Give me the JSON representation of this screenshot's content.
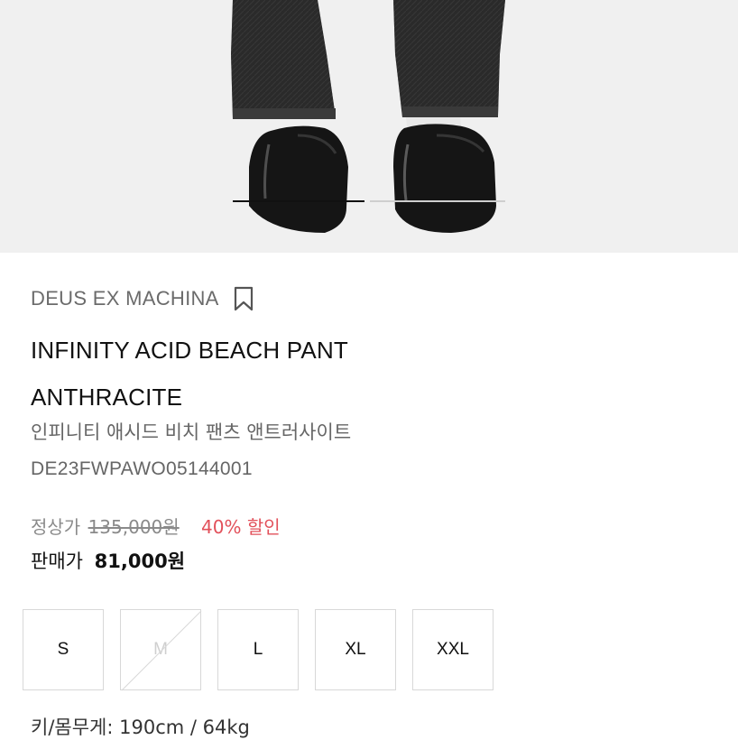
{
  "product": {
    "brand": "DEUS EX MACHINA",
    "title_line1": "INFINITY ACID BEACH PANT",
    "title_line2": "ANTHRACITE",
    "title_kr": "인피니티 애시드 비치 팬츠 앤트러사이트",
    "sku": "DE23FWPAWO05144001",
    "original_price_label": "정상가",
    "original_price": "135,000원",
    "discount_label": "40% 할인",
    "sale_price_label": "판매가",
    "sale_price": "81,000원",
    "sizes": [
      {
        "label": "S",
        "available": true
      },
      {
        "label": "M",
        "available": false
      },
      {
        "label": "L",
        "available": true
      },
      {
        "label": "XL",
        "available": true
      },
      {
        "label": "XXL",
        "available": true
      }
    ],
    "model_info": "키/몸무게: 190cm / 64kg"
  },
  "carousel": {
    "current_slide": 1,
    "total_slides": 2
  },
  "colors": {
    "accent_discount": "#e2505a",
    "hero_bg": "#f0f0f0"
  },
  "icons": {
    "bookmark": "bookmark-icon"
  }
}
